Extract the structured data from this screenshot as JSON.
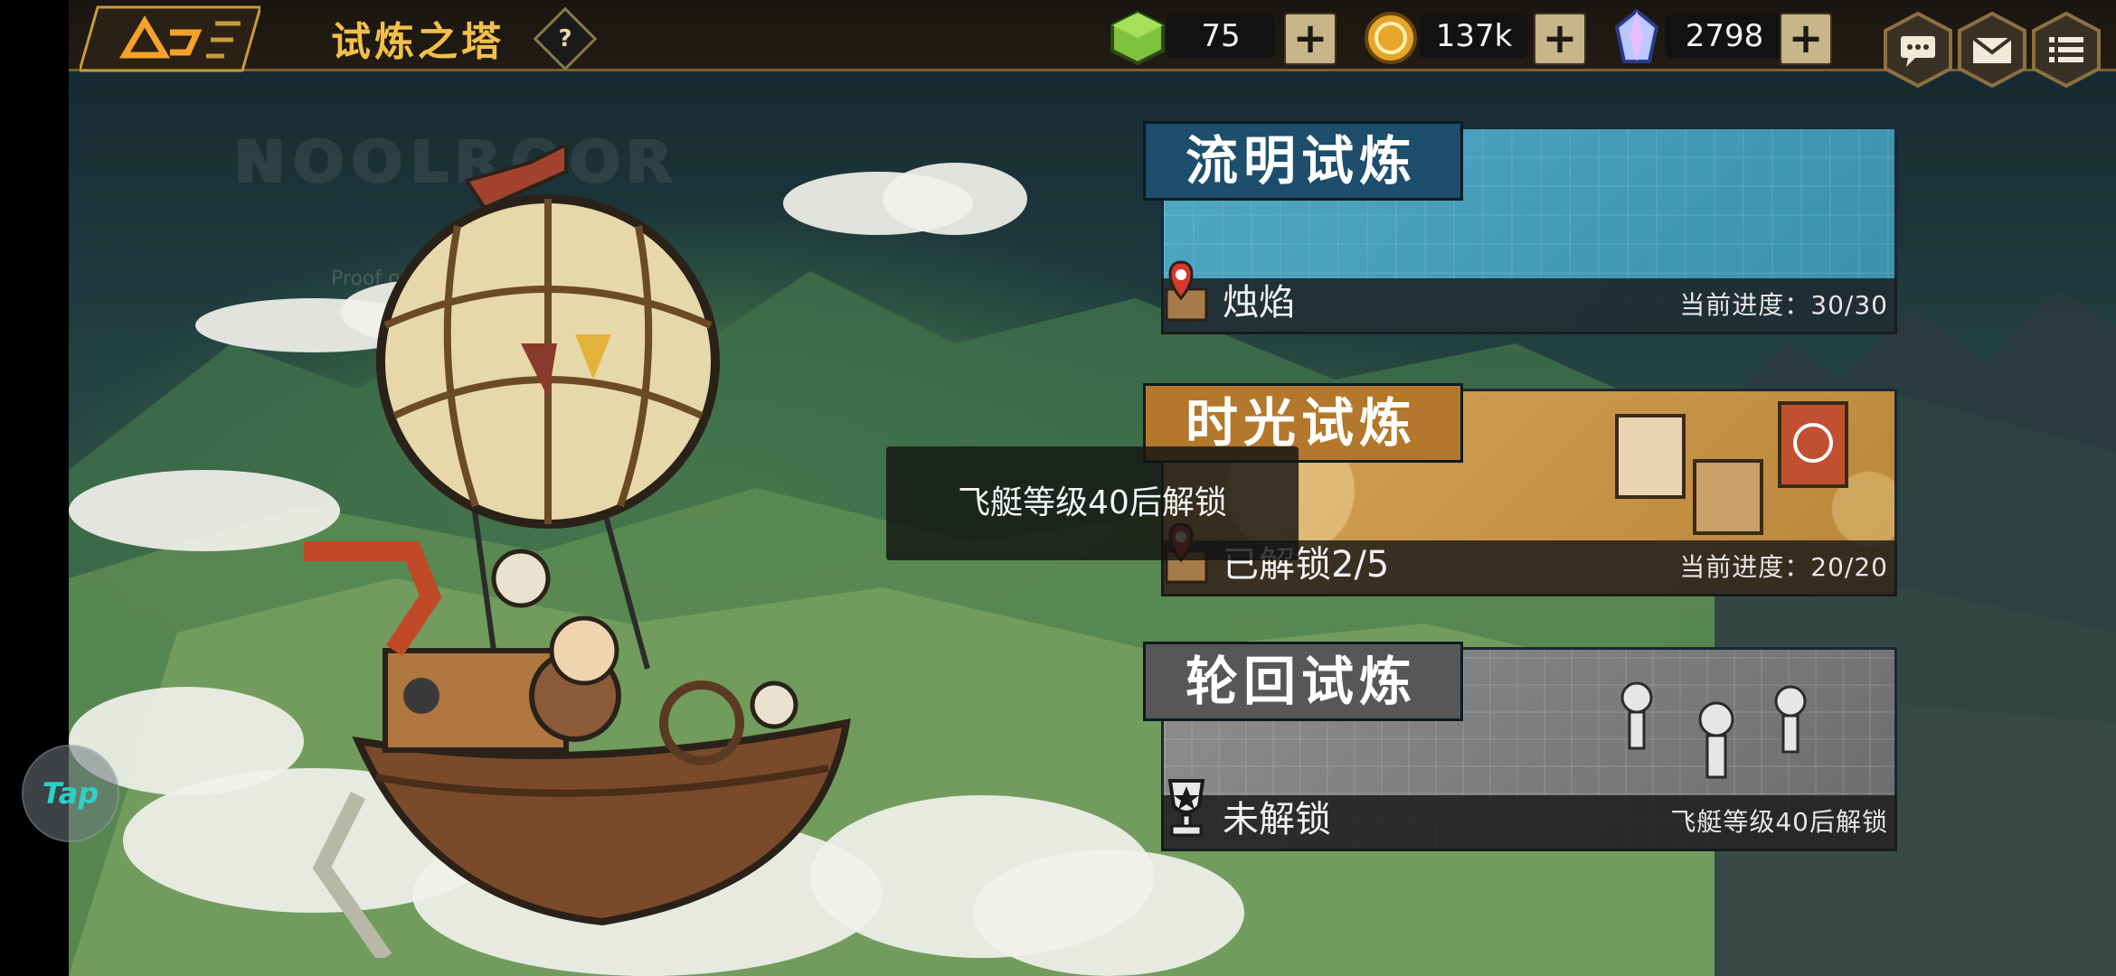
{
  "header": {
    "title": "试炼之塔",
    "help_symbol": "?"
  },
  "resources": [
    {
      "name": "stamina",
      "icon": "green-cube-icon",
      "value": "75"
    },
    {
      "name": "gold",
      "icon": "gold-coin-icon",
      "value": "137k"
    },
    {
      "name": "crystal",
      "icon": "crystal-gem-icon",
      "value": "2798"
    }
  ],
  "plus_symbol": "+",
  "top_right_buttons": [
    "chat-icon",
    "mail-icon",
    "menu-icon"
  ],
  "background": {
    "watermark": "Proof of Trial"
  },
  "trials": [
    {
      "title": "流明试炼",
      "subtitle": "烛焰",
      "progress": "当前进度：30/30",
      "icon": "map-pin-icon"
    },
    {
      "title": "时光试炼",
      "subtitle": "已解锁2/5",
      "progress": "当前进度：20/20",
      "icon": "map-pin-icon"
    },
    {
      "title": "轮回试炼",
      "subtitle": "未解锁",
      "progress": "飞艇等级40后解锁",
      "icon": "trophy-icon"
    }
  ],
  "toast": "飞艇等级40后解锁",
  "tap_button": "Tap",
  "colors": {
    "title_gold": "#f2c04a",
    "card_blue": "#1d4e6b",
    "card_gold": "#b3782b",
    "card_gray": "#575757"
  }
}
